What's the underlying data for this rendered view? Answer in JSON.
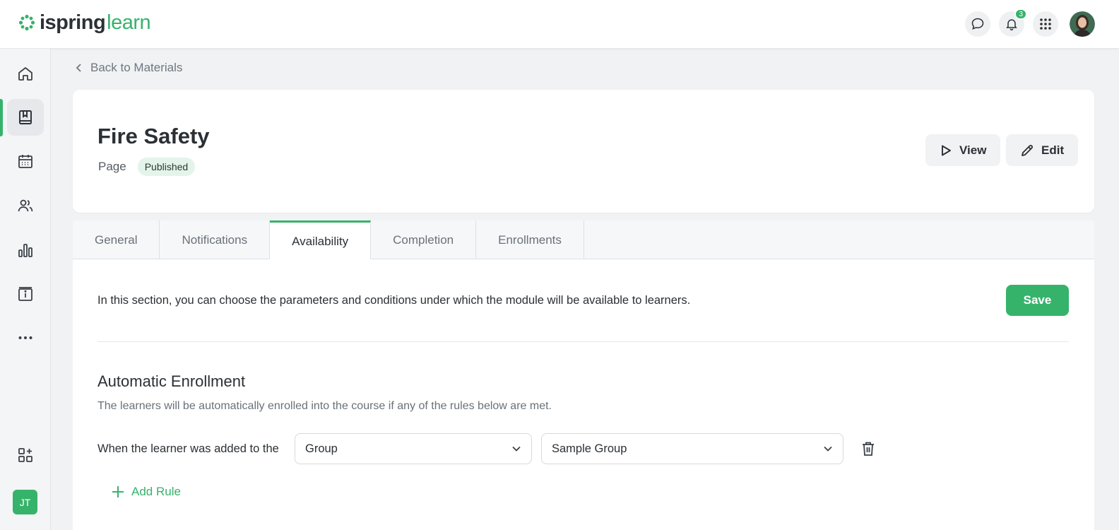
{
  "brand": {
    "name_part1": "ispring",
    "name_part2": "learn",
    "accent": "#36b36b"
  },
  "topbar": {
    "notifications_count": "3"
  },
  "sidebar": {
    "items": [
      "home-icon",
      "book-icon",
      "calendar-icon",
      "people-icon",
      "chart-icon",
      "info-icon",
      "more-icon"
    ],
    "bottom_icon": "apps-add-icon",
    "user_initials": "JT"
  },
  "back_link": {
    "label": "Back to Materials"
  },
  "header": {
    "title": "Fire Safety",
    "type": "Page",
    "status": "Published",
    "view_label": "View",
    "edit_label": "Edit"
  },
  "tabs": [
    {
      "label": "General"
    },
    {
      "label": "Notifications"
    },
    {
      "label": "Availability",
      "active": true
    },
    {
      "label": "Completion"
    },
    {
      "label": "Enrollments"
    }
  ],
  "availability": {
    "intro": "In this section, you can choose the parameters and conditions under which the module will be available to learners.",
    "save_label": "Save",
    "section_title": "Automatic Enrollment",
    "section_sub": "The learners will be automatically enrolled into the course if any of the rules below are met.",
    "rule": {
      "label": "When the learner was added to the",
      "condition": "Group",
      "value": "Sample Group"
    },
    "add_rule_label": "Add Rule"
  }
}
